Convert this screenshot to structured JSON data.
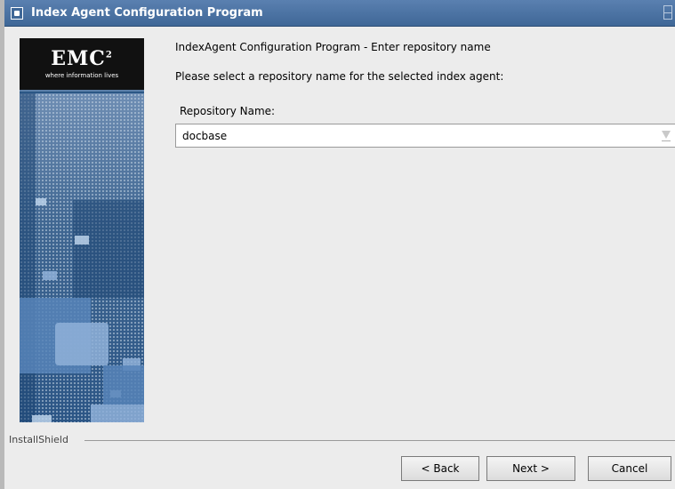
{
  "window": {
    "title": "Index Agent Configuration Program"
  },
  "logo": {
    "brand": "EMC",
    "superscript": "2",
    "tagline": "where information lives"
  },
  "content": {
    "heading": "IndexAgent Configuration Program - Enter repository name",
    "prompt": "Please select a repository name for the selected index agent:",
    "repository_label": "Repository Name:",
    "repository_value": "docbase"
  },
  "footer": {
    "brand": "InstallShield",
    "back_label": "< Back",
    "next_label": "Next >",
    "cancel_label": "Cancel"
  }
}
